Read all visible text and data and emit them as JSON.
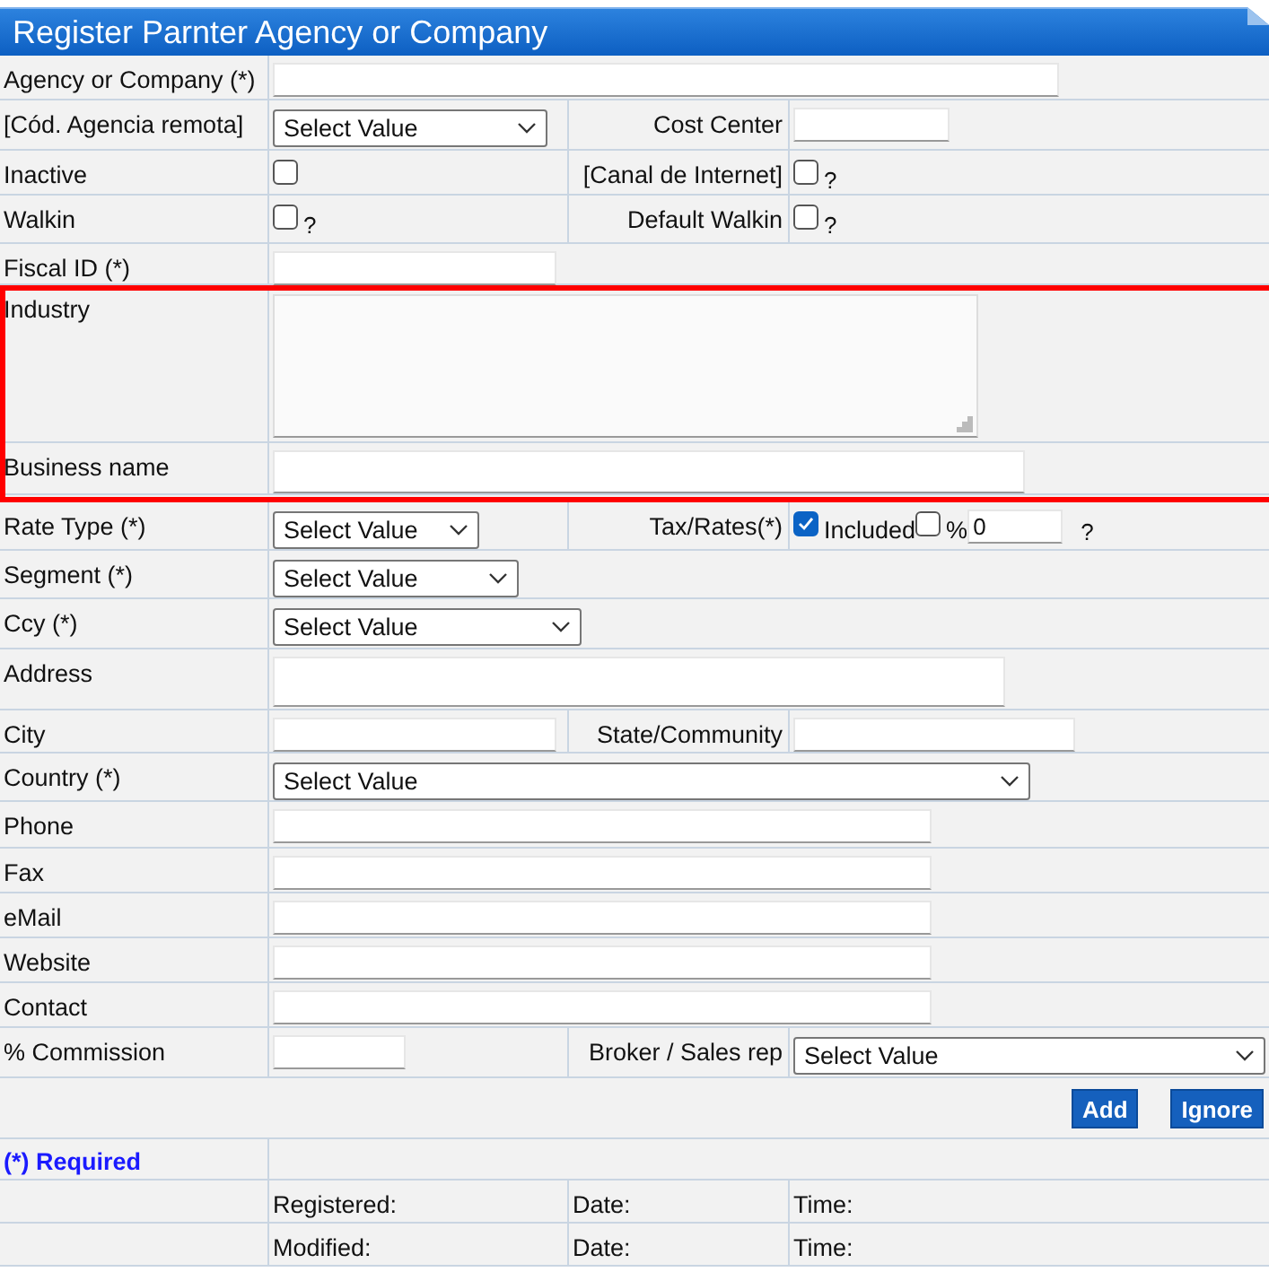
{
  "title": "Register Parnter Agency or Company",
  "rows": [
    {
      "label": "Agency or Company (*)",
      "highlighted": false,
      "fields": [
        {
          "kind": "input"
        }
      ]
    },
    {
      "label": "[Cód. Agencia remota]",
      "highlighted": false,
      "fields": [
        {
          "kind": "select",
          "value": "Select Value"
        }
      ],
      "side": {
        "label": "Cost Center",
        "fields": [
          {
            "kind": "input"
          }
        ]
      }
    },
    {
      "label": "Inactive",
      "highlighted": false,
      "fields": [
        {
          "kind": "checkbox",
          "checked": false
        }
      ],
      "side": {
        "label": "[Canal de Internet]",
        "fields": [
          {
            "kind": "checkbox",
            "checked": false
          },
          {
            "kind": "hint",
            "text": "?"
          }
        ]
      }
    },
    {
      "label": "Walkin",
      "highlighted": false,
      "fields": [
        {
          "kind": "checkbox",
          "checked": false
        },
        {
          "kind": "hint",
          "text": "?"
        }
      ],
      "side": {
        "label": "Default Walkin",
        "fields": [
          {
            "kind": "checkbox",
            "checked": false
          },
          {
            "kind": "hint",
            "text": "?"
          }
        ]
      }
    },
    {
      "label": "Fiscal ID (*)",
      "highlighted": false,
      "fields": [
        {
          "kind": "input"
        }
      ]
    },
    {
      "label": "Industry",
      "highlighted": true,
      "fields": [
        {
          "kind": "textarea"
        }
      ]
    },
    {
      "label": "Business name",
      "highlighted": true,
      "fields": [
        {
          "kind": "input"
        }
      ]
    },
    {
      "label": "Rate Type (*)",
      "highlighted": false,
      "fields": [
        {
          "kind": "select",
          "value": "Select Value"
        }
      ],
      "side": {
        "label": "Tax/Rates(*)",
        "fields": [
          {
            "kind": "checkbox",
            "checked": true
          },
          {
            "kind": "text",
            "text": "Included"
          },
          {
            "kind": "checkbox",
            "checked": false
          },
          {
            "kind": "text",
            "text": "%"
          },
          {
            "kind": "input",
            "value": "0"
          },
          {
            "kind": "hint",
            "text": "?"
          }
        ]
      }
    },
    {
      "label": "Segment (*)",
      "highlighted": false,
      "fields": [
        {
          "kind": "select",
          "value": "Select Value"
        }
      ]
    },
    {
      "label": "Ccy (*)",
      "highlighted": false,
      "fields": [
        {
          "kind": "select",
          "value": "Select Value"
        }
      ]
    },
    {
      "label": "Address",
      "highlighted": false,
      "fields": [
        {
          "kind": "input"
        }
      ]
    },
    {
      "label": "City",
      "highlighted": false,
      "fields": [
        {
          "kind": "input"
        }
      ],
      "side": {
        "label": "State/Community",
        "fields": [
          {
            "kind": "input"
          }
        ]
      }
    },
    {
      "label": "Country (*)",
      "highlighted": false,
      "fields": [
        {
          "kind": "select",
          "value": "Select Value"
        }
      ]
    },
    {
      "label": "Phone",
      "highlighted": false,
      "fields": [
        {
          "kind": "input"
        }
      ]
    },
    {
      "label": "Fax",
      "highlighted": false,
      "fields": [
        {
          "kind": "input"
        }
      ]
    },
    {
      "label": "eMail",
      "highlighted": false,
      "fields": [
        {
          "kind": "input"
        }
      ]
    },
    {
      "label": "Website",
      "highlighted": false,
      "fields": [
        {
          "kind": "input"
        }
      ]
    },
    {
      "label": "Contact",
      "highlighted": false,
      "fields": [
        {
          "kind": "input"
        }
      ]
    },
    {
      "label": "% Commission",
      "highlighted": false,
      "fields": [
        {
          "kind": "input"
        }
      ],
      "side": {
        "label": "Broker / Sales rep",
        "fields": [
          {
            "kind": "select",
            "value": "Select Value"
          }
        ]
      }
    }
  ],
  "buttons": [
    "Add",
    "Ignore"
  ],
  "required_note": "(*) Required",
  "audit": [
    {
      "label": "Registered:",
      "date": "Date:",
      "time": "Time:"
    },
    {
      "label": "Modified:",
      "date": "Date:",
      "time": "Time:"
    }
  ]
}
